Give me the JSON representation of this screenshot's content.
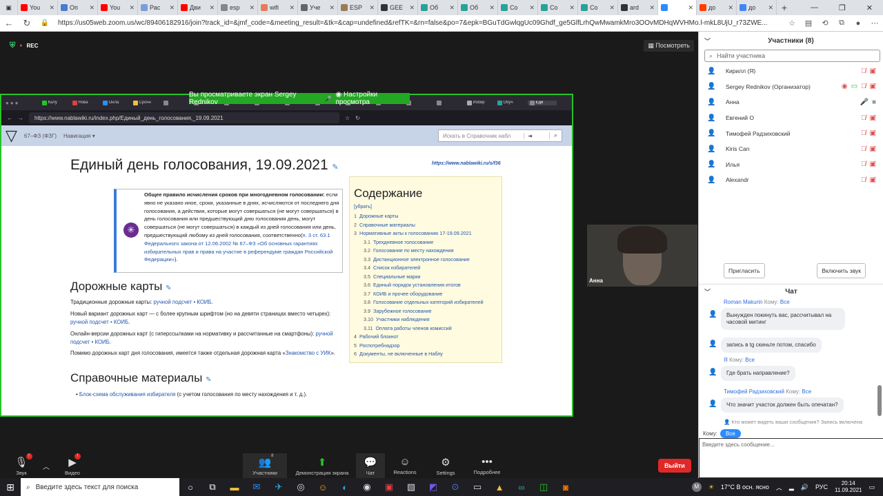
{
  "browser": {
    "tabs": [
      {
        "label": "You",
        "color": "#ff0000"
      },
      {
        "label": "Оп",
        "color": "#4a7bd0"
      },
      {
        "label": "You",
        "color": "#ff0000"
      },
      {
        "label": "Рас",
        "color": "#7b9cd9"
      },
      {
        "label": "Дви",
        "color": "#ff0000"
      },
      {
        "label": "esp",
        "color": "#888888"
      },
      {
        "label": "wifi",
        "color": "#e57c5a"
      },
      {
        "label": "Уче",
        "color": "#666666"
      },
      {
        "label": "ESP",
        "color": "#9a7b5a"
      },
      {
        "label": "GEE",
        "color": "#333333"
      },
      {
        "label": "Об",
        "color": "#2aa198"
      },
      {
        "label": "Об",
        "color": "#2aa198"
      },
      {
        "label": "Co",
        "color": "#2aa198"
      },
      {
        "label": "Co",
        "color": "#2aa198"
      },
      {
        "label": "Co",
        "color": "#2aa198"
      },
      {
        "label": "ard",
        "color": "#333333"
      },
      {
        "label": "",
        "color": "#2d8cff"
      },
      {
        "label": "до",
        "color": "#ff3d00"
      },
      {
        "label": "до",
        "color": "#4285f4"
      }
    ],
    "url": "https://us05web.zoom.us/wc/89406182916/join?track_id=&jmf_code=&meeting_result=&tk=&cap=undefined&refTK=&rn=false&po=7&epk=BGuTdGwlqgUc09Ghdf_ge5GlfLrhQwMwamkMro3OOvMDHqWVHMo.l-mkL8UjU_r73ZWE..."
  },
  "zoom": {
    "rec_label": "REC",
    "view_button": "Посмотреть",
    "share_banner": "Вы просматриваете экран Sergey Rednikov",
    "view_settings": "Настройки просмотра",
    "tile_name": "Анна",
    "toolbar": {
      "audio": "Звук",
      "video": "Видео",
      "participants": "Участники",
      "participants_count": "8",
      "share": "Демонстрация экрана",
      "chat": "Чат",
      "reactions": "Reactions",
      "settings": "Settings",
      "more": "Подробнее",
      "leave": "Выйти"
    }
  },
  "shared": {
    "tabs": [
      "Калу",
      "Нова",
      "Онла",
      "Срочн",
      "",
      "",
      "",
      "",
      "",
      "",
      "",
      "",
      "",
      "",
      "Избир",
      "Обуч",
      "Еди"
    ],
    "url": "https://www.nablawiki.ru/index.php/Единый_день_голосования,_19.09.2021",
    "wiki_section": "67–ФЗ (ФЗГ)",
    "wiki_nav": "Навигация",
    "search_placeholder": "Искать в Справочник набл",
    "h1": "Единый день голосования, 19.09.2021",
    "short_url": "https://www.nablawiki.ru/s/f36",
    "notice_bold": "Общее правило исчисления сроков при многодневном голосовании:",
    "notice_text": " если явно не указано иное, сроки, указанные в днях, исчисляются от последнего дня голосования, а действия, которые могут совершаться (не могут совершаться) в день голосования или предшествующий дню голосования день, могут совершаться (не могут совершаться) в каждый из дней голосования или день, предшествующий любому из дней голосования, соответственно(",
    "notice_link": "п. 3 ст. 63.1 Федерального закона от 12.06.2002 № 67–ФЗ «Об основных гарантиях избирательных прав и права на участие в референдуме граждан Российской Федерации»",
    "notice_end": ").",
    "toc_title": "Содержание",
    "toc_hide": "[убрать]",
    "toc": [
      {
        "n": "1",
        "t": "Дорожные карты",
        "sub": false
      },
      {
        "n": "2",
        "t": "Справочные материалы",
        "sub": false
      },
      {
        "n": "3",
        "t": "Нормативные акты к голосованию 17-19.09.2021",
        "sub": false
      },
      {
        "n": "3.1",
        "t": "Трехдневное голосование",
        "sub": true
      },
      {
        "n": "3.2",
        "t": "Голосование по месту нахождения",
        "sub": true
      },
      {
        "n": "3.3",
        "t": "Дистанционное электронное голосование",
        "sub": true
      },
      {
        "n": "3.4",
        "t": "Список избирателей",
        "sub": true
      },
      {
        "n": "3.5",
        "t": "Специальные марки",
        "sub": true
      },
      {
        "n": "3.6",
        "t": "Единый порядок установления итогов",
        "sub": true
      },
      {
        "n": "3.7",
        "t": "КОИБ и прочее оборудование",
        "sub": true
      },
      {
        "n": "3.8",
        "t": "Голосование отдельных категорий избирателей",
        "sub": true
      },
      {
        "n": "3.9",
        "t": "Зарубежное голосование",
        "sub": true
      },
      {
        "n": "3.10",
        "t": "Участники наблюдения",
        "sub": true
      },
      {
        "n": "3.11",
        "t": "Оплата работы членов комиссий",
        "sub": true
      },
      {
        "n": "4",
        "t": "Рабочий блокнот",
        "sub": false
      },
      {
        "n": "5",
        "t": "Роспотребнадзор",
        "sub": false
      },
      {
        "n": "6",
        "t": "Документы, не включенные в Наблу",
        "sub": false
      }
    ],
    "h2_roadmaps": "Дорожные карты",
    "p1": "Традиционные дорожные карты: ",
    "p1_link": "ручной подсчет • КОИБ",
    "p2": "Новый вариант дорожных карт — с более крупным шрифтом (но на девяти страницах вместо четырех): ",
    "p2_link": "ручной подсчет • КОИБ",
    "p3": "Онлайн-версии дорожных карт (с гиперссылками на нормативку и рассчитанные на смартфоны): ",
    "p3_link": "ручной подсчет • КОИБ",
    "p4": "Помимо дорожных карт дня голосования, имеется также отдельная дорожная карта «",
    "p4_link": "Знакомство с УИК",
    "p4_end": "».",
    "h2_ref": "Справочные материалы",
    "p5_link": "Блок-схема обслуживания избирателя",
    "p5": " (с учетом голосования по месту нахождения и т. д.)."
  },
  "participants": {
    "title": "Участники (8)",
    "search_placeholder": "Найти участника",
    "list": [
      {
        "name": "Кирилл (Я)",
        "host": false,
        "sharing": false,
        "mic": "off",
        "cam": "off"
      },
      {
        "name": "Sergey Rednikov (Организатор)",
        "host": true,
        "sharing": true,
        "mic": "off",
        "cam": "off"
      },
      {
        "name": "Анна",
        "host": false,
        "sharing": false,
        "mic": "on",
        "cam": "on"
      },
      {
        "name": "Евгений О",
        "host": false,
        "sharing": false,
        "mic": "off",
        "cam": "off"
      },
      {
        "name": "Тимофей Радзиховский",
        "host": false,
        "sharing": false,
        "mic": "off",
        "cam": "off"
      },
      {
        "name": "Kiris Can",
        "host": false,
        "sharing": false,
        "mic": "off",
        "cam": "off"
      },
      {
        "name": "Илья",
        "host": false,
        "sharing": false,
        "mic": "off",
        "cam": "off"
      },
      {
        "name": "Alexandr",
        "host": false,
        "sharing": false,
        "mic": "off",
        "cam": "off"
      }
    ],
    "invite": "Пригласить",
    "unmute_all": "Включить звук"
  },
  "chat": {
    "title": "Чат",
    "messages": [
      {
        "from": "Roman Makurin",
        "to": "Кому:",
        "to_name": "Все",
        "text": "Вынужден покинуть вас, рассчитывал на часовой митинг"
      },
      {
        "from": "",
        "to": "",
        "to_name": "",
        "text": "запись в tg скиньте потом, спасибо"
      },
      {
        "from": "Я",
        "to": "Кому:",
        "to_name": "Все",
        "text": "Где брать направление?"
      },
      {
        "from": "Тимофей Радзиховский",
        "to": "Кому:",
        "to_name": "Все",
        "text": "Что значит участок должен быть опечатан?"
      }
    ],
    "who_can_see": "Кто может видеть ваши сообщения? Запись включена",
    "to_label": "Кому:",
    "to_value": "Все",
    "input_placeholder": "Введите здесь сообщение..."
  },
  "taskbar": {
    "search_placeholder": "Введите здесь текст для поиска",
    "weather": "17°C  В осн. ясно",
    "lang": "РУС",
    "time": "20:14",
    "date": "11.09.2021"
  }
}
